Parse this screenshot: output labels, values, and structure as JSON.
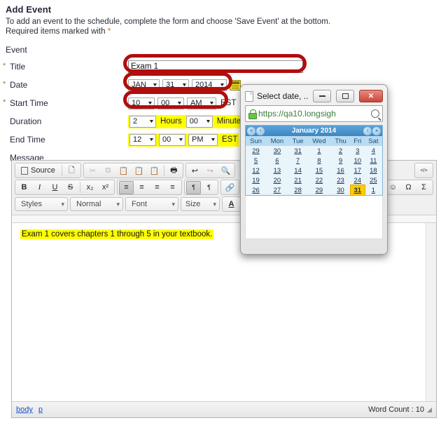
{
  "page": {
    "title": "Add Event",
    "instruction_line1": "To add an event to the schedule, complete the form and choose 'Save Event' at the bottom.",
    "instruction_line2_prefix": "Required items marked with ",
    "instruction_line2_star": "*",
    "section_label": "Event"
  },
  "form": {
    "title": {
      "label": "Title",
      "required_marker": "*",
      "value": "Exam 1"
    },
    "date": {
      "label": "Date",
      "required_marker": "*",
      "month": "JAN",
      "day": "31",
      "year": "2014",
      "picker_icon": "calendar-icon"
    },
    "start_time": {
      "label": "Start Time",
      "required_marker": "*",
      "hour": "10",
      "minute": "00",
      "meridiem": "AM",
      "timezone": "EST"
    },
    "duration": {
      "label": "Duration",
      "hours": "2",
      "hours_unit": "Hours",
      "minutes": "00",
      "minutes_unit": "Minutes"
    },
    "end_time": {
      "label": "End Time",
      "hour": "12",
      "minute": "00",
      "meridiem": "PM",
      "timezone": "EST"
    },
    "message": {
      "label": "Message"
    }
  },
  "editor": {
    "toolbar_row1": {
      "source_label": "Source",
      "templates_icon": "templates-icon",
      "cut_icon": "cut-icon",
      "copy_icon": "copy-icon",
      "paste_icon": "paste-icon",
      "paste_text_icon": "paste-text-icon",
      "paste_word_icon": "paste-word-icon",
      "print_icon": "print-icon",
      "undo_icon": "undo-icon",
      "redo_icon": "redo-icon",
      "find_icon": "find-icon",
      "html_snippet_icon": "html-snippet-icon"
    },
    "toolbar_row2": {
      "bold": "B",
      "italic": "I",
      "underline": "U",
      "strike": "S",
      "subscript": "x₂",
      "superscript": "x²",
      "align_left_icon": "align-left-icon",
      "align_center_icon": "align-center-icon",
      "align_right_icon": "align-right-icon",
      "align_justify_icon": "align-justify-icon",
      "ltr_icon": "text-direction-ltr-icon",
      "rtl_icon": "text-direction-rtl-icon",
      "link_icon": "link-icon",
      "smiley_icon": "smiley-icon",
      "special_char": "Ω",
      "sigma_char": "Σ"
    },
    "toolbar_row3": {
      "styles": "Styles",
      "format": "Normal",
      "font": "Font",
      "size": "Size",
      "text_color_icon": "text-color-icon"
    },
    "content": "Exam 1 covers chapters 1 through 5 in your textbook.",
    "footer": {
      "path_body": "body",
      "path_p": "p",
      "word_count": "Word Count : 10"
    }
  },
  "popup": {
    "window_title": "Select date, ...",
    "minimize_label": "minimize-button",
    "maximize_label": "maximize-button",
    "close_label": "✕",
    "url": "https://qa10.longsigh",
    "calendar": {
      "month_year": "January 2014",
      "prev_year_icon": "«",
      "prev_month_icon": "‹",
      "next_month_icon": "›",
      "next_year_icon": "»",
      "weekdays": [
        "Sun",
        "Mon",
        "Tue",
        "Wed",
        "Thu",
        "Fri",
        "Sat"
      ],
      "weeks": [
        [
          "29",
          "30",
          "31",
          "1",
          "2",
          "3",
          "4"
        ],
        [
          "5",
          "6",
          "7",
          "8",
          "9",
          "10",
          "11"
        ],
        [
          "12",
          "13",
          "14",
          "15",
          "16",
          "17",
          "18"
        ],
        [
          "19",
          "20",
          "21",
          "22",
          "23",
          "24",
          "25"
        ],
        [
          "26",
          "27",
          "28",
          "29",
          "30",
          "31",
          "1"
        ]
      ],
      "selected_day": "31",
      "selected_row": 4,
      "selected_col": 5
    }
  },
  "annotations": {
    "accent_red": "#b10d0d",
    "highlight_yellow": "#ffff00",
    "boxes": [
      "title-field",
      "date-field",
      "start-time-field"
    ]
  }
}
